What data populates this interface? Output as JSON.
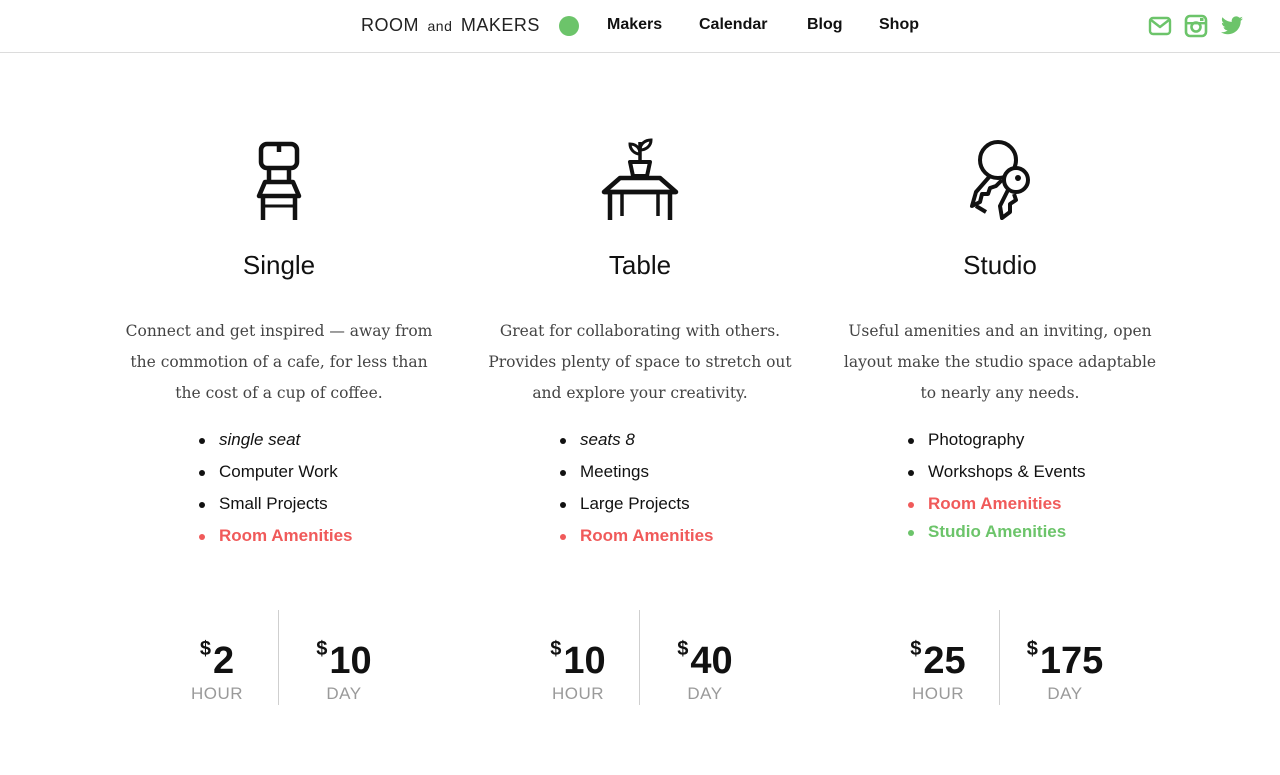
{
  "header": {
    "brand_left": "ROOM",
    "brand_and": "and",
    "brand_right": "MAKERS",
    "status_color": "#6cc46a",
    "nav": [
      {
        "label": "Makers"
      },
      {
        "label": "Calendar"
      },
      {
        "label": "Blog"
      },
      {
        "label": "Shop"
      }
    ],
    "social": [
      {
        "icon": "mail-icon"
      },
      {
        "icon": "instagram-icon"
      },
      {
        "icon": "twitter-icon"
      }
    ],
    "accent": "#6cc46a"
  },
  "colors": {
    "amenity_red": "#f05a5a",
    "amenity_green": "#6cc46a",
    "muted": "#9a9a9a"
  },
  "plans": [
    {
      "icon": "chair-icon",
      "title": "Single",
      "description": "Connect and get inspired — away from the commotion of a cafe, for less than the cost of a cup of coffee.",
      "features": [
        "single seat",
        "Computer Work",
        "Small Projects"
      ],
      "amenities": [
        "Room Amenities"
      ],
      "prices": [
        {
          "currency": "$",
          "amount": "2",
          "unit": "HOUR"
        },
        {
          "currency": "$",
          "amount": "10",
          "unit": "DAY"
        }
      ]
    },
    {
      "icon": "table-plant-icon",
      "title": "Table",
      "description": "Great for collaborating with others. Provides plenty of space to stretch out and explore your creativity.",
      "features": [
        "seats 8",
        "Meetings",
        "Large Projects"
      ],
      "amenities": [
        "Room Amenities"
      ],
      "prices": [
        {
          "currency": "$",
          "amount": "10",
          "unit": "HOUR"
        },
        {
          "currency": "$",
          "amount": "40",
          "unit": "DAY"
        }
      ]
    },
    {
      "icon": "keys-icon",
      "title": "Studio",
      "description": "Useful amenities and an inviting, open layout make the studio space adaptable to nearly any needs.",
      "features": [
        "Photography",
        "Workshops & Events"
      ],
      "amenities": [
        "Room Amenities",
        "Studio Amenities"
      ],
      "prices": [
        {
          "currency": "$",
          "amount": "25",
          "unit": "HOUR"
        },
        {
          "currency": "$",
          "amount": "175",
          "unit": "DAY"
        }
      ]
    }
  ]
}
